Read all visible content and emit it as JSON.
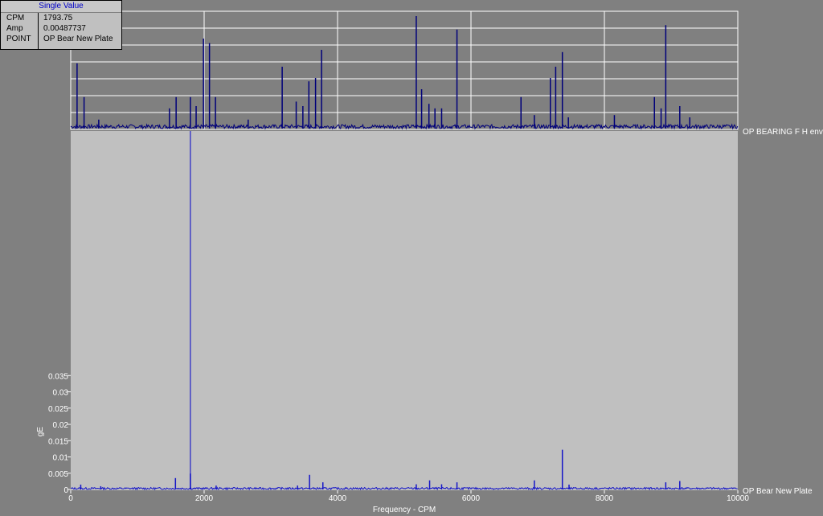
{
  "info_box": {
    "title": "Single Value",
    "rows": [
      {
        "key": "CPM",
        "value": "1793.75"
      },
      {
        "key": "Amp",
        "value": "0.00487737"
      },
      {
        "key": "POINT",
        "value": "OP Bear New Plate"
      }
    ]
  },
  "colors": {
    "background": "#808080",
    "plot_background": "#c0c0c0",
    "trace": "#00007a",
    "trace_bottom": "#1414c8",
    "cursor": "#0000c8",
    "grid": "#ffffff"
  },
  "chart_data": [
    {
      "type": "line",
      "series": [
        {
          "name": "OP BEARING F H env"
        }
      ],
      "grid": true,
      "xlim": [
        0,
        10000
      ],
      "peaks": [
        {
          "x": 95,
          "y": 0.58
        },
        {
          "x": 200,
          "y": 0.28
        },
        {
          "x": 420,
          "y": 0.08
        },
        {
          "x": 1480,
          "y": 0.18
        },
        {
          "x": 1580,
          "y": 0.28
        },
        {
          "x": 1793.75,
          "y": 0.28
        },
        {
          "x": 1880,
          "y": 0.2
        },
        {
          "x": 1990,
          "y": 0.8
        },
        {
          "x": 2080,
          "y": 0.76
        },
        {
          "x": 2170,
          "y": 0.28
        },
        {
          "x": 2660,
          "y": 0.08
        },
        {
          "x": 3170,
          "y": 0.55
        },
        {
          "x": 3380,
          "y": 0.24
        },
        {
          "x": 3480,
          "y": 0.2
        },
        {
          "x": 3570,
          "y": 0.42
        },
        {
          "x": 3670,
          "y": 0.45
        },
        {
          "x": 3760,
          "y": 0.7
        },
        {
          "x": 5180,
          "y": 1.0
        },
        {
          "x": 5260,
          "y": 0.35
        },
        {
          "x": 5370,
          "y": 0.22
        },
        {
          "x": 5460,
          "y": 0.18
        },
        {
          "x": 5560,
          "y": 0.18
        },
        {
          "x": 5790,
          "y": 0.88
        },
        {
          "x": 6750,
          "y": 0.28
        },
        {
          "x": 6950,
          "y": 0.12
        },
        {
          "x": 7190,
          "y": 0.45
        },
        {
          "x": 7270,
          "y": 0.55
        },
        {
          "x": 7370,
          "y": 0.68
        },
        {
          "x": 7460,
          "y": 0.1
        },
        {
          "x": 8150,
          "y": 0.12
        },
        {
          "x": 8750,
          "y": 0.28
        },
        {
          "x": 8850,
          "y": 0.18
        },
        {
          "x": 8920,
          "y": 0.92
        },
        {
          "x": 9130,
          "y": 0.2
        },
        {
          "x": 9280,
          "y": 0.1
        }
      ]
    },
    {
      "type": "line",
      "series": [
        {
          "name": "OP Bear New Plate"
        }
      ],
      "xlabel": "Frequency - CPM",
      "ylabel": "gE",
      "xlim": [
        0,
        10000
      ],
      "ylim": [
        0,
        0.04
      ],
      "x_ticks": [
        "0",
        "2000",
        "4000",
        "6000",
        "8000",
        "10000"
      ],
      "y_ticks": [
        "0",
        "0.005",
        "0.01",
        "0.015",
        "0.02",
        "0.025",
        "0.03",
        "0.035"
      ],
      "cursor": {
        "x": 1793.75,
        "y": 0.00487737
      },
      "peaks": [
        {
          "x": 150,
          "y": 0.0015
        },
        {
          "x": 450,
          "y": 0.001
        },
        {
          "x": 1570,
          "y": 0.0035
        },
        {
          "x": 1793.75,
          "y": 0.00487737
        },
        {
          "x": 2180,
          "y": 0.0012
        },
        {
          "x": 3400,
          "y": 0.0012
        },
        {
          "x": 3580,
          "y": 0.0045
        },
        {
          "x": 3780,
          "y": 0.0022
        },
        {
          "x": 5180,
          "y": 0.0016
        },
        {
          "x": 5380,
          "y": 0.0028
        },
        {
          "x": 5560,
          "y": 0.0016
        },
        {
          "x": 5790,
          "y": 0.0022
        },
        {
          "x": 6950,
          "y": 0.0028
        },
        {
          "x": 7370,
          "y": 0.0122
        },
        {
          "x": 7470,
          "y": 0.0015
        },
        {
          "x": 8920,
          "y": 0.0022
        },
        {
          "x": 9130,
          "y": 0.0026
        }
      ]
    }
  ]
}
